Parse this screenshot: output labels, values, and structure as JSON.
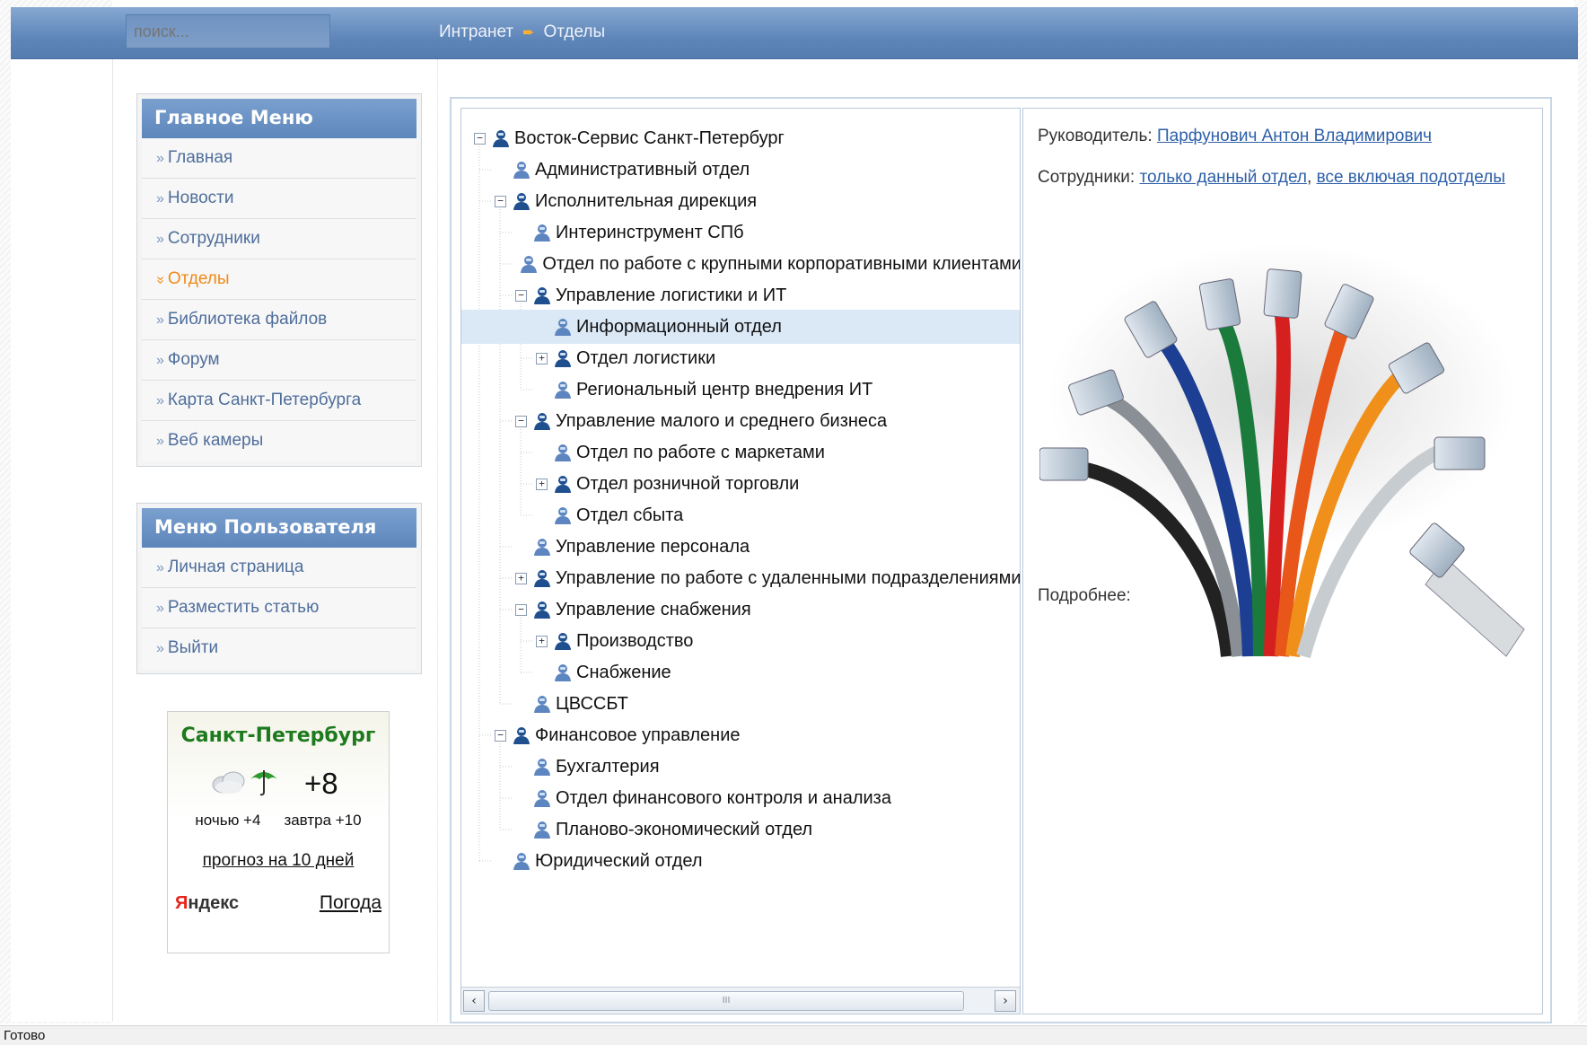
{
  "search": {
    "placeholder": "поиск..."
  },
  "breadcrumb": {
    "root": "Интранет",
    "current": "Отделы"
  },
  "main_menu": {
    "title": "Главное Меню",
    "items": [
      {
        "label": "Главная"
      },
      {
        "label": "Новости"
      },
      {
        "label": "Сотрудники"
      },
      {
        "label": "Отделы",
        "active": true
      },
      {
        "label": "Библиотека файлов"
      },
      {
        "label": "Форум"
      },
      {
        "label": "Карта Санкт-Петербурга"
      },
      {
        "label": "Веб камеры"
      }
    ]
  },
  "user_menu": {
    "title": "Меню Пользователя",
    "items": [
      {
        "label": "Личная страница"
      },
      {
        "label": "Разместить статью"
      },
      {
        "label": "Выйти"
      }
    ]
  },
  "weather": {
    "city": "Санкт-Петербург",
    "temp": "+8",
    "night": "ночью +4",
    "tomorrow": "завтра +10",
    "ten_days": "прогноз на 10 дней",
    "yandex_y": "Я",
    "yandex_rest": "ндекс",
    "pogoda": "Погода",
    "icons": [
      "cloud-icon",
      "umbrella-icon"
    ]
  },
  "tree": {
    "nodes": [
      {
        "label": "Восток-Сервис Санкт-Петербург",
        "level": 0,
        "toggle": "minus",
        "group": true
      },
      {
        "label": "Административный отдел",
        "level": 1,
        "toggle": "none",
        "group": false
      },
      {
        "label": "Исполнительная дирекция",
        "level": 1,
        "toggle": "minus",
        "group": true
      },
      {
        "label": "Интеринструмент СПб",
        "level": 2,
        "toggle": "none",
        "group": false
      },
      {
        "label": "Отдел по работе с крупными корпоративными клиентами",
        "level": 2,
        "toggle": "none",
        "group": false
      },
      {
        "label": "Управление логистики и ИТ",
        "level": 2,
        "toggle": "minus",
        "group": true
      },
      {
        "label": "Информационный отдел",
        "level": 3,
        "toggle": "none",
        "group": false,
        "selected": true
      },
      {
        "label": "Отдел логистики",
        "level": 3,
        "toggle": "plus",
        "group": true
      },
      {
        "label": "Региональный центр внедрения ИТ",
        "level": 3,
        "toggle": "none",
        "group": false
      },
      {
        "label": "Управление малого и среднего бизнеса",
        "level": 2,
        "toggle": "minus",
        "group": true
      },
      {
        "label": "Отдел по работе с маркетами",
        "level": 3,
        "toggle": "none",
        "group": false
      },
      {
        "label": "Отдел розничной торговли",
        "level": 3,
        "toggle": "plus",
        "group": true
      },
      {
        "label": "Отдел сбыта",
        "level": 3,
        "toggle": "none",
        "group": false
      },
      {
        "label": "Управление персонала",
        "level": 2,
        "toggle": "none",
        "group": false
      },
      {
        "label": "Управление по работе с удаленными подразделениями",
        "level": 2,
        "toggle": "plus",
        "group": true
      },
      {
        "label": "Управление снабжения",
        "level": 2,
        "toggle": "minus",
        "group": true
      },
      {
        "label": "Производство",
        "level": 3,
        "toggle": "plus",
        "group": true
      },
      {
        "label": "Снабжение",
        "level": 3,
        "toggle": "none",
        "group": false
      },
      {
        "label": "ЦВССБТ",
        "level": 2,
        "toggle": "none",
        "group": false
      },
      {
        "label": "Финансовое управление",
        "level": 1,
        "toggle": "minus",
        "group": true
      },
      {
        "label": "Бухгалтерия",
        "level": 2,
        "toggle": "none",
        "group": false
      },
      {
        "label": "Отдел финансового контроля и анализа",
        "level": 2,
        "toggle": "none",
        "group": false
      },
      {
        "label": "Планово-экономический отдел",
        "level": 2,
        "toggle": "none",
        "group": false
      },
      {
        "label": "Юридический отдел",
        "level": 1,
        "toggle": "none",
        "group": false
      }
    ],
    "scroll_left": "‹",
    "scroll_right": "›",
    "scroll_grip": "III"
  },
  "details": {
    "head_label": "Руководитель:",
    "head_value": "Парфунович Антон Владимирович",
    "staff_label": "Сотрудники:",
    "staff_link1": "только данный отдел",
    "staff_sep": ",",
    "staff_link2": "все включая подотделы",
    "more_label": "Подробнее:"
  },
  "status": {
    "text": "Готово"
  },
  "colors": {
    "accent": "#5f86b9",
    "active_menu": "#f08a17",
    "link": "#2d5fa8",
    "selected_row": "#dbe8f6"
  }
}
